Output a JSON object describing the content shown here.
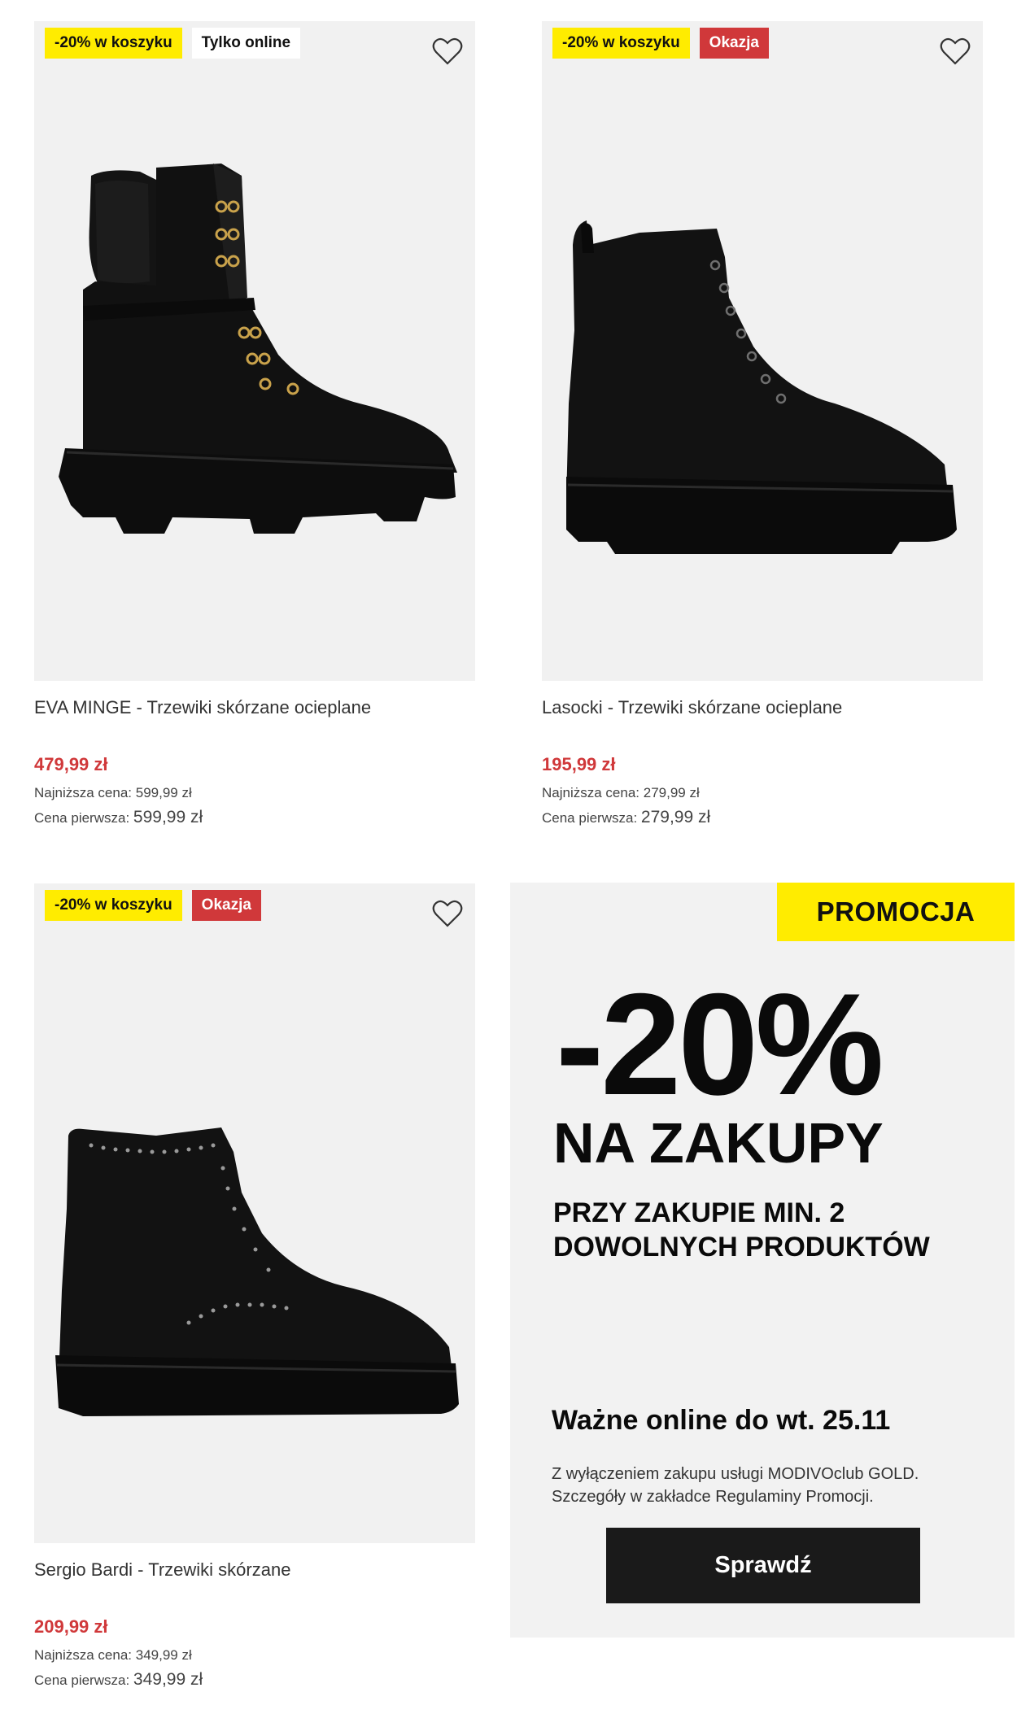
{
  "products": [
    {
      "badges": [
        {
          "text": "-20% w koszyku",
          "style": "yellow"
        },
        {
          "text": "Tylko online",
          "style": "white"
        }
      ],
      "title": "EVA MINGE - Trzewiki skórzane ocieplane",
      "price": "479,99 zł",
      "lowest_label": "Najniższa cena:",
      "lowest_value": "599,99 zł",
      "first_label": "Cena pierwsza:",
      "first_value": "599,99 zł",
      "icon": "heart-icon"
    },
    {
      "badges": [
        {
          "text": "-20% w koszyku",
          "style": "yellow"
        },
        {
          "text": "Okazja",
          "style": "red"
        }
      ],
      "title": "Lasocki - Trzewiki skórzane ocieplane",
      "price": "195,99 zł",
      "lowest_label": "Najniższa cena:",
      "lowest_value": "279,99 zł",
      "first_label": "Cena pierwsza:",
      "first_value": "279,99 zł",
      "icon": "heart-icon"
    },
    {
      "badges": [
        {
          "text": "-20% w koszyku",
          "style": "yellow"
        },
        {
          "text": "Okazja",
          "style": "red"
        }
      ],
      "title": "Sergio Bardi - Trzewiki skórzane",
      "price": "209,99 zł",
      "lowest_label": "Najniższa cena:",
      "lowest_value": "349,99 zł",
      "first_label": "Cena pierwsza:",
      "first_value": "349,99 zł",
      "icon": "heart-icon"
    }
  ],
  "promo": {
    "tag": "PROMOCJA",
    "discount": "-20%",
    "headline": "NA ZAKUPY",
    "subline": "PRZY ZAKUPIE MIN. 2 DOWOLNYCH PRODUKTÓW",
    "valid": "Ważne online do wt. 25.11",
    "fine_print": "Z wyłączeniem zakupu usługi MODIVOclub GOLD. Szczegóły w zakładce Regulaminy Promocji.",
    "button": "Sprawdź"
  },
  "colors": {
    "yellow": "#ffec00",
    "red": "#d0383a",
    "dark": "#1a1a1a"
  }
}
